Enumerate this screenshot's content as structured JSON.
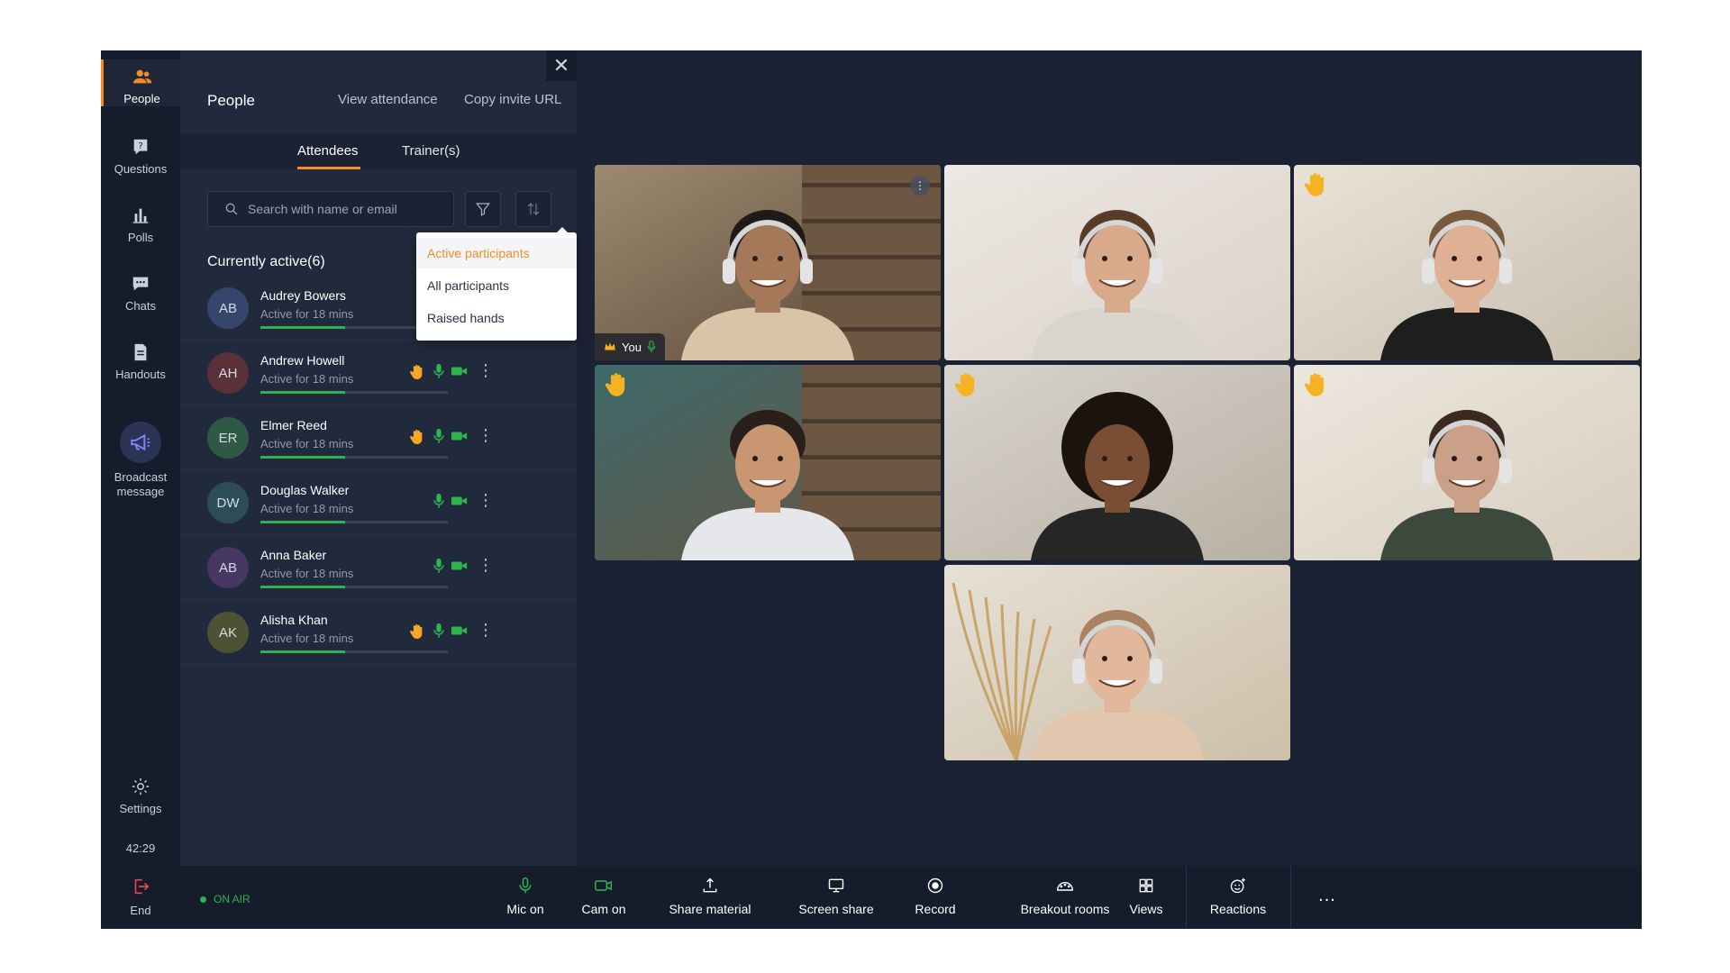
{
  "rail": {
    "items": [
      {
        "label": "People",
        "icon": "people-icon"
      },
      {
        "label": "Questions",
        "icon": "question-icon"
      },
      {
        "label": "Polls",
        "icon": "polls-icon"
      },
      {
        "label": "Chats",
        "icon": "chat-icon"
      },
      {
        "label": "Handouts",
        "icon": "handout-icon"
      },
      {
        "label": "Broadcast message",
        "icon": "megaphone-icon"
      },
      {
        "label": "Settings",
        "icon": "gear-icon"
      }
    ],
    "timer": "42:29"
  },
  "panel": {
    "title": "People",
    "view_attendance": "View attendance",
    "copy_invite": "Copy invite URL",
    "tabs": [
      "Attendees",
      "Trainer(s)"
    ],
    "search_placeholder": "Search with name or email",
    "section_title": "Currently active(6)",
    "filter_options": [
      "Active participants",
      "All participants",
      "Raised hands"
    ],
    "participants": [
      {
        "initials": "AB",
        "name": "Audrey Bowers",
        "status": "Active for 18 mins",
        "hand": false,
        "avatar_color": "#35456b",
        "progress": 0.45
      },
      {
        "initials": "AH",
        "name": "Andrew Howell",
        "status": "Active for 18 mins",
        "hand": true,
        "avatar_color": "#5a3138",
        "progress": 0.45
      },
      {
        "initials": "ER",
        "name": "Elmer Reed",
        "status": "Active for 18 mins",
        "hand": true,
        "avatar_color": "#2e5a45",
        "progress": 0.45
      },
      {
        "initials": "DW",
        "name": "Douglas Walker",
        "status": "Active for 18 mins",
        "hand": false,
        "avatar_color": "#2c4d57",
        "progress": 0.45
      },
      {
        "initials": "AB",
        "name": "Anna Baker",
        "status": "Active for 18 mins",
        "hand": false,
        "avatar_color": "#473763",
        "progress": 0.45
      },
      {
        "initials": "AK",
        "name": "Alisha Khan",
        "status": "Active for 18 mins",
        "hand": true,
        "avatar_color": "#4d5233",
        "progress": 0.45
      }
    ]
  },
  "videos": {
    "you_label": "You",
    "raised_hand_tiles": [
      2,
      3,
      4,
      5
    ]
  },
  "bottombar": {
    "end": "End",
    "on_air": "ON AIR",
    "tools": [
      "Mic on",
      "Cam on",
      "Share material",
      "Screen share",
      "Record",
      "Breakout rooms",
      "Views",
      "Reactions"
    ],
    "more": "..."
  },
  "colors": {
    "accent": "#f28c28",
    "active_green": "#2fb34e",
    "background": "#1b2233",
    "rail": "#151c2b",
    "panel": "#212a3c"
  }
}
